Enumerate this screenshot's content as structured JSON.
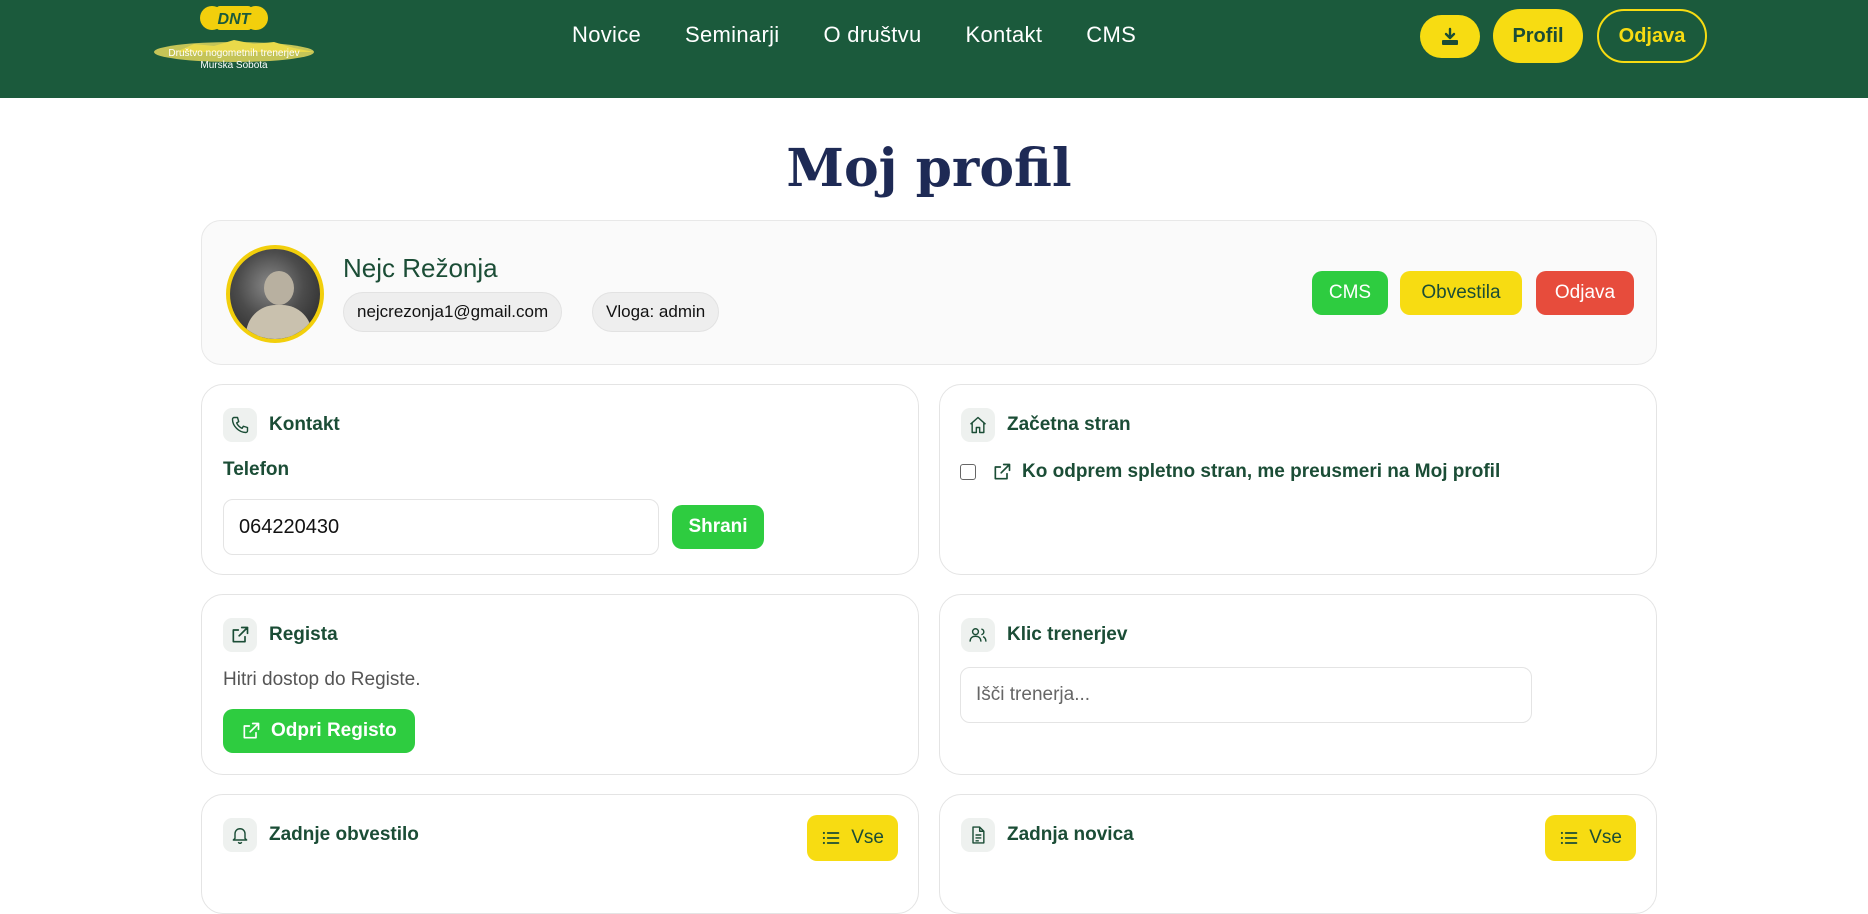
{
  "header": {
    "logo_mark": "DNT",
    "logo_line1": "Društvo nogometnih trenerjev",
    "logo_line2": "Murska Sobota",
    "nav": [
      "Novice",
      "Seminarji",
      "O društvu",
      "Kontakt",
      "CMS"
    ],
    "download_icon": "download-icon",
    "profil_label": "Profil",
    "odjava_label": "Odjava"
  },
  "page_title": "Moj profil",
  "profile": {
    "name": "Nejc Režonja",
    "email": "nejcrezonja1@gmail.com",
    "role": "Vloga: admin",
    "buttons": {
      "cms": "CMS",
      "obvestila": "Obvestila",
      "odjava": "Odjava"
    }
  },
  "kontakt": {
    "title": "Kontakt",
    "icon": "phone-icon",
    "field_label": "Telefon",
    "phone_value": "064220430",
    "save_label": "Shrani"
  },
  "zacetna": {
    "title": "Začetna stran",
    "icon": "home-icon",
    "checkbox_checked": false,
    "checkbox_label": "Ko odprem spletno stran, me preusmeri na Moj profil"
  },
  "regista": {
    "title": "Regista",
    "icon": "external-link-icon",
    "description": "Hitri dostop do Registe.",
    "open_label": "Odpri Registo"
  },
  "klic": {
    "title": "Klic trenerjev",
    "icon": "users-icon",
    "search_placeholder": "Išči trenerja..."
  },
  "obvestilo": {
    "title": "Zadnje obvestilo",
    "icon": "bell-icon",
    "all_label": "Vse"
  },
  "novica": {
    "title": "Zadnja novica",
    "icon": "document-icon",
    "all_label": "Vse"
  },
  "colors": {
    "header_bg": "#1b5a3c",
    "accent_yellow": "#f7dc12",
    "accent_green": "#2ecc40",
    "danger_red": "#e74c3c",
    "title_navy": "#1e2a55",
    "text_green": "#1b4d36"
  }
}
